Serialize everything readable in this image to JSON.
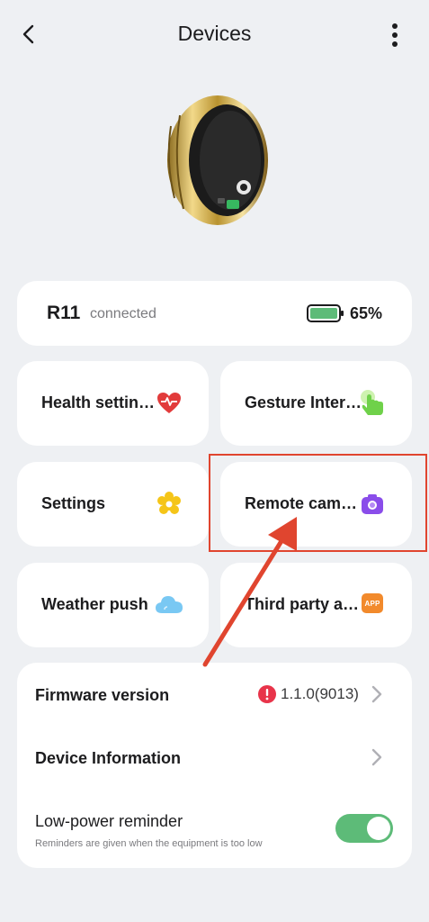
{
  "header": {
    "title": "Devices"
  },
  "device": {
    "name": "R11",
    "status": "connected",
    "battery": "65%"
  },
  "tiles": [
    {
      "label": "Health settin…",
      "icon": "heart-pulse-icon"
    },
    {
      "label": "Gesture Inter…",
      "icon": "hand-tap-icon"
    },
    {
      "label": "Settings",
      "icon": "gear-flower-icon"
    },
    {
      "label": "Remote cam…",
      "icon": "camera-icon"
    },
    {
      "label": "Weather push",
      "icon": "cloud-icon"
    },
    {
      "label": "Third party a…",
      "icon": "app-icon",
      "badge": "APP"
    }
  ],
  "list": {
    "firmware": {
      "label": "Firmware version",
      "value": "1.1.0(9013)"
    },
    "device_info": {
      "label": "Device Information"
    },
    "low_power": {
      "label": "Low-power reminder",
      "sub": "Reminders are given when the equipment is too low",
      "enabled": true
    }
  },
  "colors": {
    "accent_green": "#5dbb78",
    "annotation_red": "#e0452f"
  }
}
